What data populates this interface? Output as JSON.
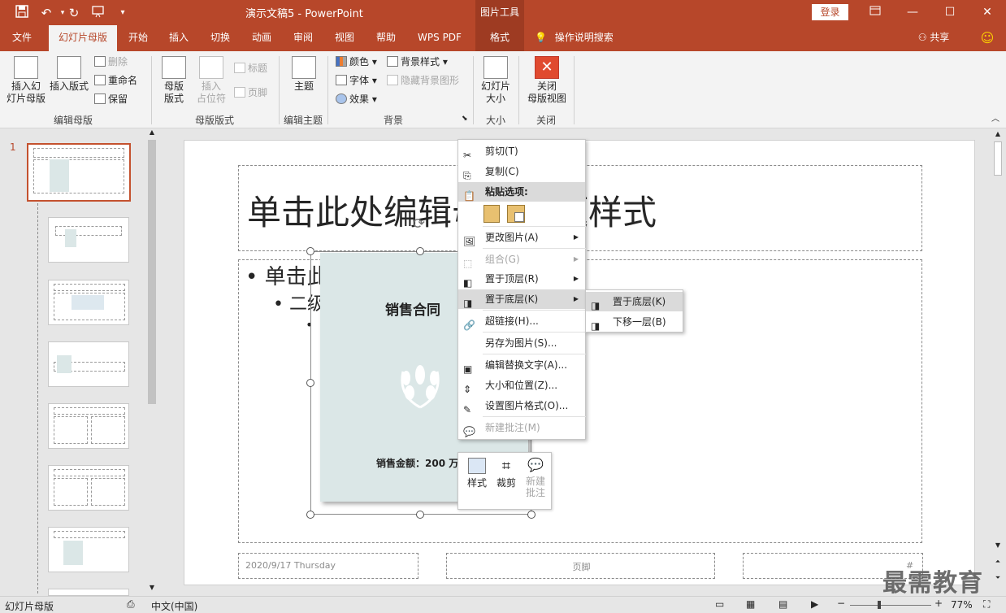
{
  "titlebar": {
    "doc_title": "演示文稿5  -  PowerPoint",
    "context_tools": "图片工具",
    "login": "登录"
  },
  "tabs": [
    "文件",
    "幻灯片母版",
    "开始",
    "插入",
    "切换",
    "动画",
    "审阅",
    "视图",
    "帮助",
    "WPS PDF",
    "格式"
  ],
  "tell_me": "操作说明搜索",
  "share": "共享",
  "ribbon": {
    "insert_master": "插入幻\n灯片母版",
    "insert_layout": "插入版式",
    "delete": "删除",
    "rename": "重命名",
    "preserve": "保留",
    "group_edit_master": "编辑母版",
    "master_layout": "母版\n版式",
    "insert_placeholder": "插入\n占位符",
    "title_check": "标题",
    "footer_check": "页脚",
    "group_master_layout": "母版版式",
    "theme": "主题",
    "group_edit_theme": "编辑主题",
    "colors": "颜色",
    "fonts": "字体",
    "effects": "效果",
    "bg_styles": "背景样式",
    "hide_bg": "隐藏背景图形",
    "group_background": "背景",
    "slide_size": "幻灯片\n大小",
    "group_size": "大小",
    "close_master": "关闭\n母版视图",
    "group_close": "关闭"
  },
  "slide_number": "1",
  "slide": {
    "title": "单击此处编辑母版标题样式",
    "bullet1": "单击此",
    "bullet2": "二级",
    "contract_title": "销售合同",
    "contract_amount": "销售金额：200 万",
    "date": "2020/9/17 Thursday",
    "footer": "页脚",
    "num": "#"
  },
  "menu": {
    "cut": "剪切(T)",
    "copy": "复制(C)",
    "paste_options": "粘贴选项:",
    "change_picture": "更改图片(A)",
    "group": "组合(G)",
    "bring_front": "置于顶层(R)",
    "send_back": "置于底层(K)",
    "hyperlink": "超链接(H)...",
    "save_as_pic": "另存为图片(S)...",
    "alt_text": "编辑替换文字(A)...",
    "size_pos": "大小和位置(Z)...",
    "format_pic": "设置图片格式(O)...",
    "new_comment": "新建批注(M)"
  },
  "submenu": {
    "send_to_back": "置于底层(K)",
    "send_backward": "下移一层(B)"
  },
  "minitoolbar": {
    "style": "样式",
    "crop": "裁剪",
    "new_comment": "新建\n批注"
  },
  "status": {
    "view": "幻灯片母版",
    "lang": "中文(中国)",
    "zoom": "77%"
  },
  "watermark": "最需教育",
  "colors": {
    "accent": "#b7472a"
  }
}
